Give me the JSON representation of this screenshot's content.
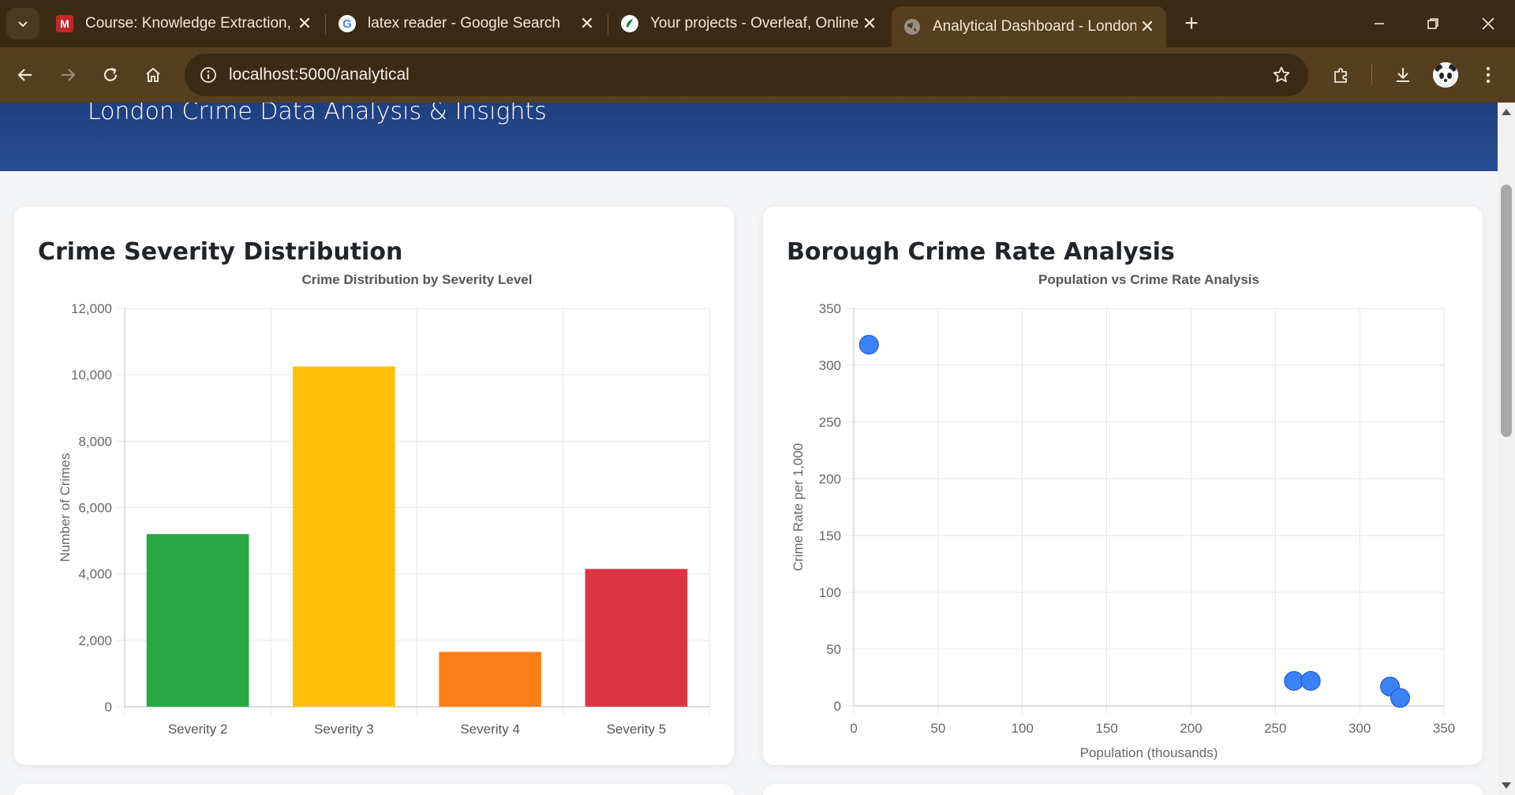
{
  "browser": {
    "tabs": [
      {
        "title": "Course: Knowledge Extraction, I",
        "favicon": "moodle-icon"
      },
      {
        "title": "latex reader - Google Search",
        "favicon": "google-icon"
      },
      {
        "title": "Your projects - Overleaf, Online",
        "favicon": "overleaf-icon"
      },
      {
        "title": "Analytical Dashboard - London",
        "favicon": "globe-icon",
        "active": true
      }
    ],
    "url": "localhost:5000/analytical"
  },
  "header": {
    "subtitle": "London Crime Data Analysis & Insights"
  },
  "severity_card": {
    "title": "Crime Severity Distribution"
  },
  "borough_card": {
    "title": "Borough Crime Rate Analysis"
  },
  "chart_data": [
    {
      "type": "bar",
      "title": "Crime Distribution by Severity Level",
      "xlabel": "",
      "ylabel": "Number of Crimes",
      "categories": [
        "Severity 2",
        "Severity 3",
        "Severity 4",
        "Severity 5"
      ],
      "values": [
        5200,
        10250,
        1650,
        4150
      ],
      "colors": [
        "#28a745",
        "#ffc107",
        "#fd7e14",
        "#dc3545"
      ],
      "ylim": [
        0,
        12000
      ],
      "yticks": [
        "0",
        "2,000",
        "4,000",
        "6,000",
        "8,000",
        "10,000",
        "12,000"
      ],
      "grid": true
    },
    {
      "type": "scatter",
      "title": "Population vs Crime Rate Analysis",
      "xlabel": "Population (thousands)",
      "ylabel": "Crime Rate per 1,000",
      "points": [
        {
          "x": 9,
          "y": 318
        },
        {
          "x": 261,
          "y": 22
        },
        {
          "x": 271,
          "y": 22
        },
        {
          "x": 318,
          "y": 17
        },
        {
          "x": 324,
          "y": 7
        }
      ],
      "color": "#3b82f6",
      "xlim": [
        0,
        350
      ],
      "ylim": [
        0,
        350
      ],
      "xticks": [
        "0",
        "50",
        "100",
        "150",
        "200",
        "250",
        "300",
        "350"
      ],
      "yticks": [
        "0",
        "50",
        "100",
        "150",
        "200",
        "250",
        "300",
        "350"
      ],
      "grid": true
    }
  ]
}
